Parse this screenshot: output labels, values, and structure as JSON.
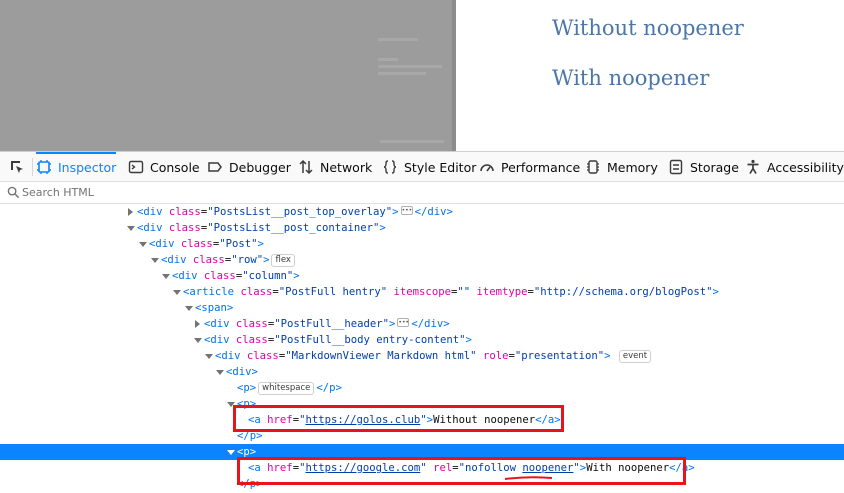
{
  "page": {
    "links": [
      "Without noopener",
      "With noopener"
    ],
    "link_color": "#4a76a8"
  },
  "toolbar": {
    "picker_icon": "element-picker-icon",
    "tabs": [
      {
        "label": "Inspector",
        "icon": "inspector-icon",
        "active": true
      },
      {
        "label": "Console",
        "icon": "console-icon"
      },
      {
        "label": "Debugger",
        "icon": "debugger-icon"
      },
      {
        "label": "Network",
        "icon": "network-icon"
      },
      {
        "label": "Style Editor",
        "icon": "style-editor-icon"
      },
      {
        "label": "Performance",
        "icon": "performance-icon"
      },
      {
        "label": "Memory",
        "icon": "memory-icon"
      },
      {
        "label": "Storage",
        "icon": "storage-icon"
      },
      {
        "label": "Accessibility",
        "icon": "accessibility-icon"
      }
    ],
    "active_color": "#0a84ff"
  },
  "search": {
    "placeholder": "Search HTML",
    "value": ""
  },
  "tree": {
    "rows": [
      {
        "lt": "<",
        "tag": "div",
        "a1": "class",
        "v1": "\"PostsList__post_top_overlay\"",
        "gt": ">",
        "badge": "",
        "close": "</div>"
      },
      {
        "lt": "<",
        "tag": "div",
        "a1": "class",
        "v1": "\"PostsList__post_container\"",
        "gt": ">"
      },
      {
        "lt": "<",
        "tag": "div",
        "a1": "class",
        "v1": "\"Post\"",
        "gt": ">"
      },
      {
        "lt": "<",
        "tag": "div",
        "a1": "class",
        "v1": "\"row\"",
        "gt": ">",
        "badge": "flex"
      },
      {
        "lt": "<",
        "tag": "div",
        "a1": "class",
        "v1": "\"column\"",
        "gt": ">"
      },
      {
        "lt": "<",
        "tag": "article",
        "a1": "class",
        "v1": "\"PostFull hentry\"",
        "a2": "itemscope",
        "v2": "\"\"",
        "a3": "itemtype",
        "v3": "\"http://schema.org/blogPost\"",
        "gt": ">"
      },
      {
        "lt": "<",
        "tag": "span",
        "gt": ">"
      },
      {
        "lt": "<",
        "tag": "div",
        "a1": "class",
        "v1": "\"PostFull__header\"",
        "gt": ">",
        "close": "</div>"
      },
      {
        "lt": "<",
        "tag": "div",
        "a1": "class",
        "v1": "\"PostFull__body entry-content\"",
        "gt": ">"
      },
      {
        "lt": "<",
        "tag": "div",
        "a1": "class",
        "v1": "\"MarkdownViewer Markdown html\"",
        "a2": "role",
        "v2": "\"presentation\"",
        "gt": ">",
        "badge": "event"
      },
      {
        "lt": "<",
        "tag": "div",
        "gt": ">"
      },
      {
        "lt": "<",
        "tag": "p",
        "gt": ">",
        "badge": "whitespace",
        "close": "</p>"
      },
      {
        "lt": "<",
        "tag": "p",
        "gt": ">"
      },
      {
        "lt": "<",
        "tag": "a",
        "a1": "href",
        "q": "\"",
        "url": "https://golos.club",
        "gt": ">",
        "text": "Without noopener",
        "close": "</a>"
      },
      {
        "lt": "",
        "tag": "",
        "close": "</p>"
      },
      {
        "lt": "<",
        "tag": "p",
        "gt": ">"
      },
      {
        "lt": "<",
        "tag": "a",
        "a1": "href",
        "q": "\"",
        "url": "https://google.com",
        "a2": "rel",
        "v2a": "\"nofollow ",
        "v2b": "noopener",
        "v2c": "\"",
        "gt": ">",
        "text": "With noopener",
        "close": "</a>"
      },
      {
        "lt": "",
        "tag": "",
        "close": "</p>"
      }
    ]
  },
  "colors": {
    "tag": "#0074e8",
    "attr_name": "#dd00a9",
    "attr_value": "#003eaa",
    "selection": "#0a84ff",
    "annotation": "#e8141c"
  }
}
